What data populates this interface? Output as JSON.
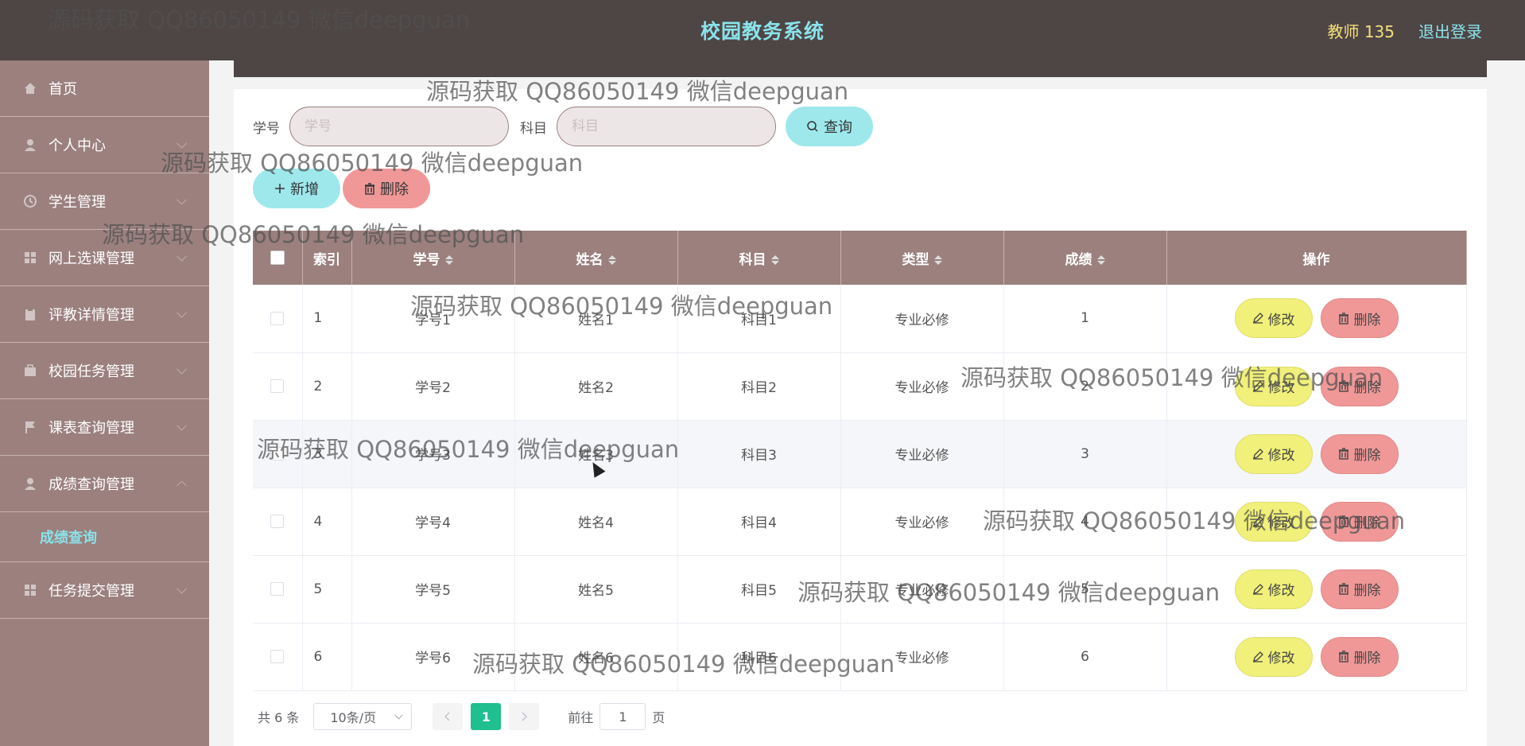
{
  "header": {
    "title": "校园教务系统",
    "user_label": "教师 135",
    "logout_label": "退出登录"
  },
  "sidebar": {
    "items": [
      {
        "label": "首页",
        "icon": "home-icon"
      },
      {
        "label": "个人中心",
        "icon": "user-icon"
      },
      {
        "label": "学生管理",
        "icon": "clock-icon"
      },
      {
        "label": "网上选课管理",
        "icon": "grid-icon"
      },
      {
        "label": "评教详情管理",
        "icon": "clipboard-icon"
      },
      {
        "label": "校园任务管理",
        "icon": "briefcase-icon"
      },
      {
        "label": "课表查询管理",
        "icon": "flag-icon"
      },
      {
        "label": "成绩查询管理",
        "icon": "user-icon"
      },
      {
        "label": "任务提交管理",
        "icon": "grid-icon"
      }
    ],
    "active_submenu": "成绩查询"
  },
  "search": {
    "student_id_label": "学号",
    "student_id_placeholder": "学号",
    "subject_label": "科目",
    "subject_placeholder": "科目",
    "query_button": "查询"
  },
  "actions": {
    "add_button": "新增",
    "delete_button": "删除"
  },
  "table": {
    "headers": [
      "索引",
      "学号",
      "姓名",
      "科目",
      "类型",
      "成绩",
      "操作"
    ],
    "rows": [
      {
        "index": "1",
        "student_id": "学号1",
        "name": "姓名1",
        "subject": "科目1",
        "type": "专业必修",
        "score": "1"
      },
      {
        "index": "2",
        "student_id": "学号2",
        "name": "姓名2",
        "subject": "科目2",
        "type": "专业必修",
        "score": "2"
      },
      {
        "index": "3",
        "student_id": "学号3",
        "name": "姓名3",
        "subject": "科目3",
        "type": "专业必修",
        "score": "3"
      },
      {
        "index": "4",
        "student_id": "学号4",
        "name": "姓名4",
        "subject": "科目4",
        "type": "专业必修",
        "score": "4"
      },
      {
        "index": "5",
        "student_id": "学号5",
        "name": "姓名5",
        "subject": "科目5",
        "type": "专业必修",
        "score": "5"
      },
      {
        "index": "6",
        "student_id": "学号6",
        "name": "姓名6",
        "subject": "科目6",
        "type": "专业必修",
        "score": "6"
      }
    ],
    "edit_label": "修改",
    "delete_label": "删除"
  },
  "pagination": {
    "total": "共 6 条",
    "page_size": "10条/页",
    "current_page": "1",
    "goto_prefix": "前往",
    "goto_value": "1",
    "goto_suffix": "页"
  },
  "watermark": "源码获取 QQ86050149 微信deepguan",
  "colors": {
    "header_bg": "#4e4545",
    "sidebar_bg": "#9b807e",
    "accent_cyan": "#8ae3ea",
    "edit_yellow": "#f0f07a",
    "delete_red": "#f09898",
    "page_active": "#1fbf8f"
  }
}
